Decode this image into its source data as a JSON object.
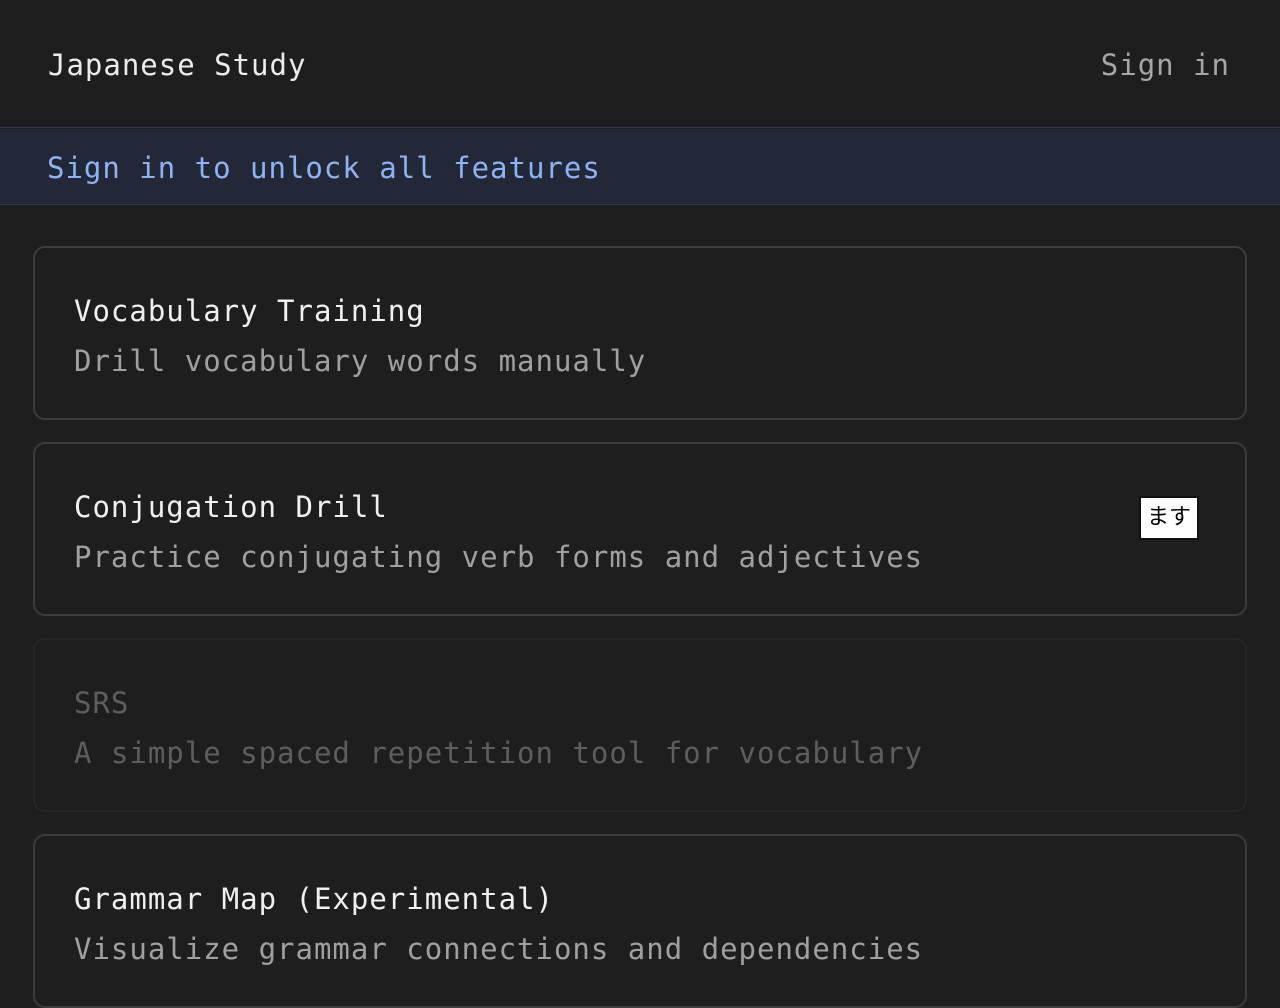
{
  "header": {
    "title": "Japanese Study",
    "sign_in_label": "Sign in"
  },
  "banner": {
    "text": "Sign in to unlock all features"
  },
  "cards": [
    {
      "title": "Vocabulary Training",
      "description": "Drill vocabulary words manually",
      "enabled": true
    },
    {
      "title": "Conjugation Drill",
      "description": "Practice conjugating verb forms and adjectives",
      "badge": "ます",
      "enabled": true
    },
    {
      "title": "SRS",
      "description": "A simple spaced repetition tool for vocabulary",
      "enabled": false
    },
    {
      "title": "Grammar Map (Experimental)",
      "description": "Visualize grammar connections and dependencies",
      "enabled": true
    }
  ],
  "colors": {
    "background": "#1e1e1e",
    "banner_background": "#222838",
    "banner_text": "#8cb4f5",
    "card_border": "#3c3c3c",
    "disabled_text": "#5e5e5e"
  }
}
